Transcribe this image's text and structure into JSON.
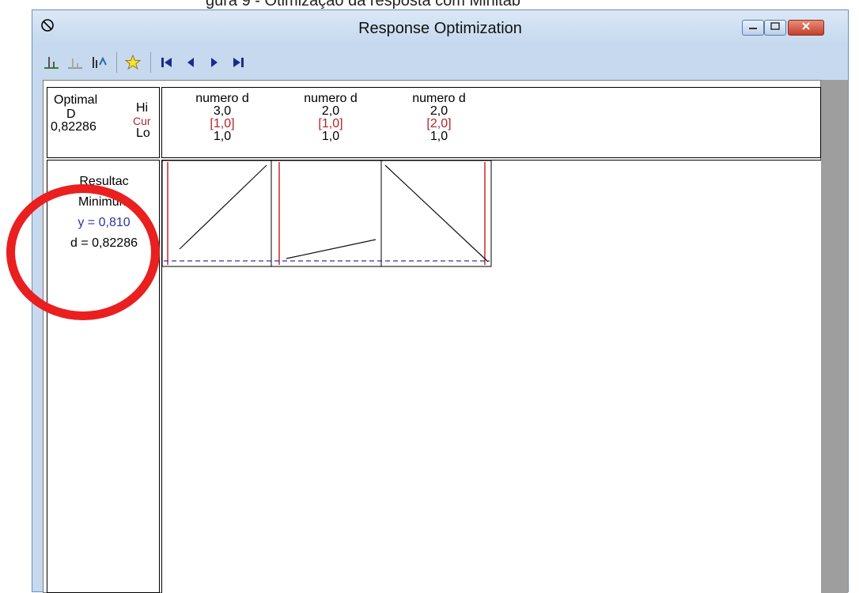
{
  "caption_text": "gura 9 - Otimização da resposta com Minitab",
  "window": {
    "title": "Response Optimization",
    "icon": "no-symbol-icon",
    "controls": [
      "minimize-icon",
      "maximize-icon",
      "close-icon"
    ]
  },
  "toolbar": {
    "icons": [
      "edit-factor-settings-icon",
      "restore-settings-icon",
      "sequential-optimization-icon",
      "save-optimal-star-icon",
      "first-icon",
      "previous-icon",
      "next-icon",
      "last-icon"
    ]
  },
  "optimal": {
    "label": "Optimal",
    "d_label": "D",
    "d_value": "0,82286",
    "hi": "Hi",
    "cur": "Cur",
    "lo": "Lo"
  },
  "factors": [
    {
      "name": "numero d",
      "hi": "3,0",
      "cur": "[1,0]",
      "lo": "1,0"
    },
    {
      "name": "numero d",
      "hi": "2,0",
      "cur": "[1,0]",
      "lo": "1,0"
    },
    {
      "name": "numero d",
      "hi": "2,0",
      "cur": "[2,0]",
      "lo": "1,0"
    }
  ],
  "response": {
    "name": "Resultac",
    "goal": "Minimum",
    "y": "y = 0,810",
    "d": "d = 0,82286"
  },
  "colors": {
    "current_line": "#c8282a",
    "target_line": "#2b35a8",
    "annotation": "#ea1f1f"
  }
}
